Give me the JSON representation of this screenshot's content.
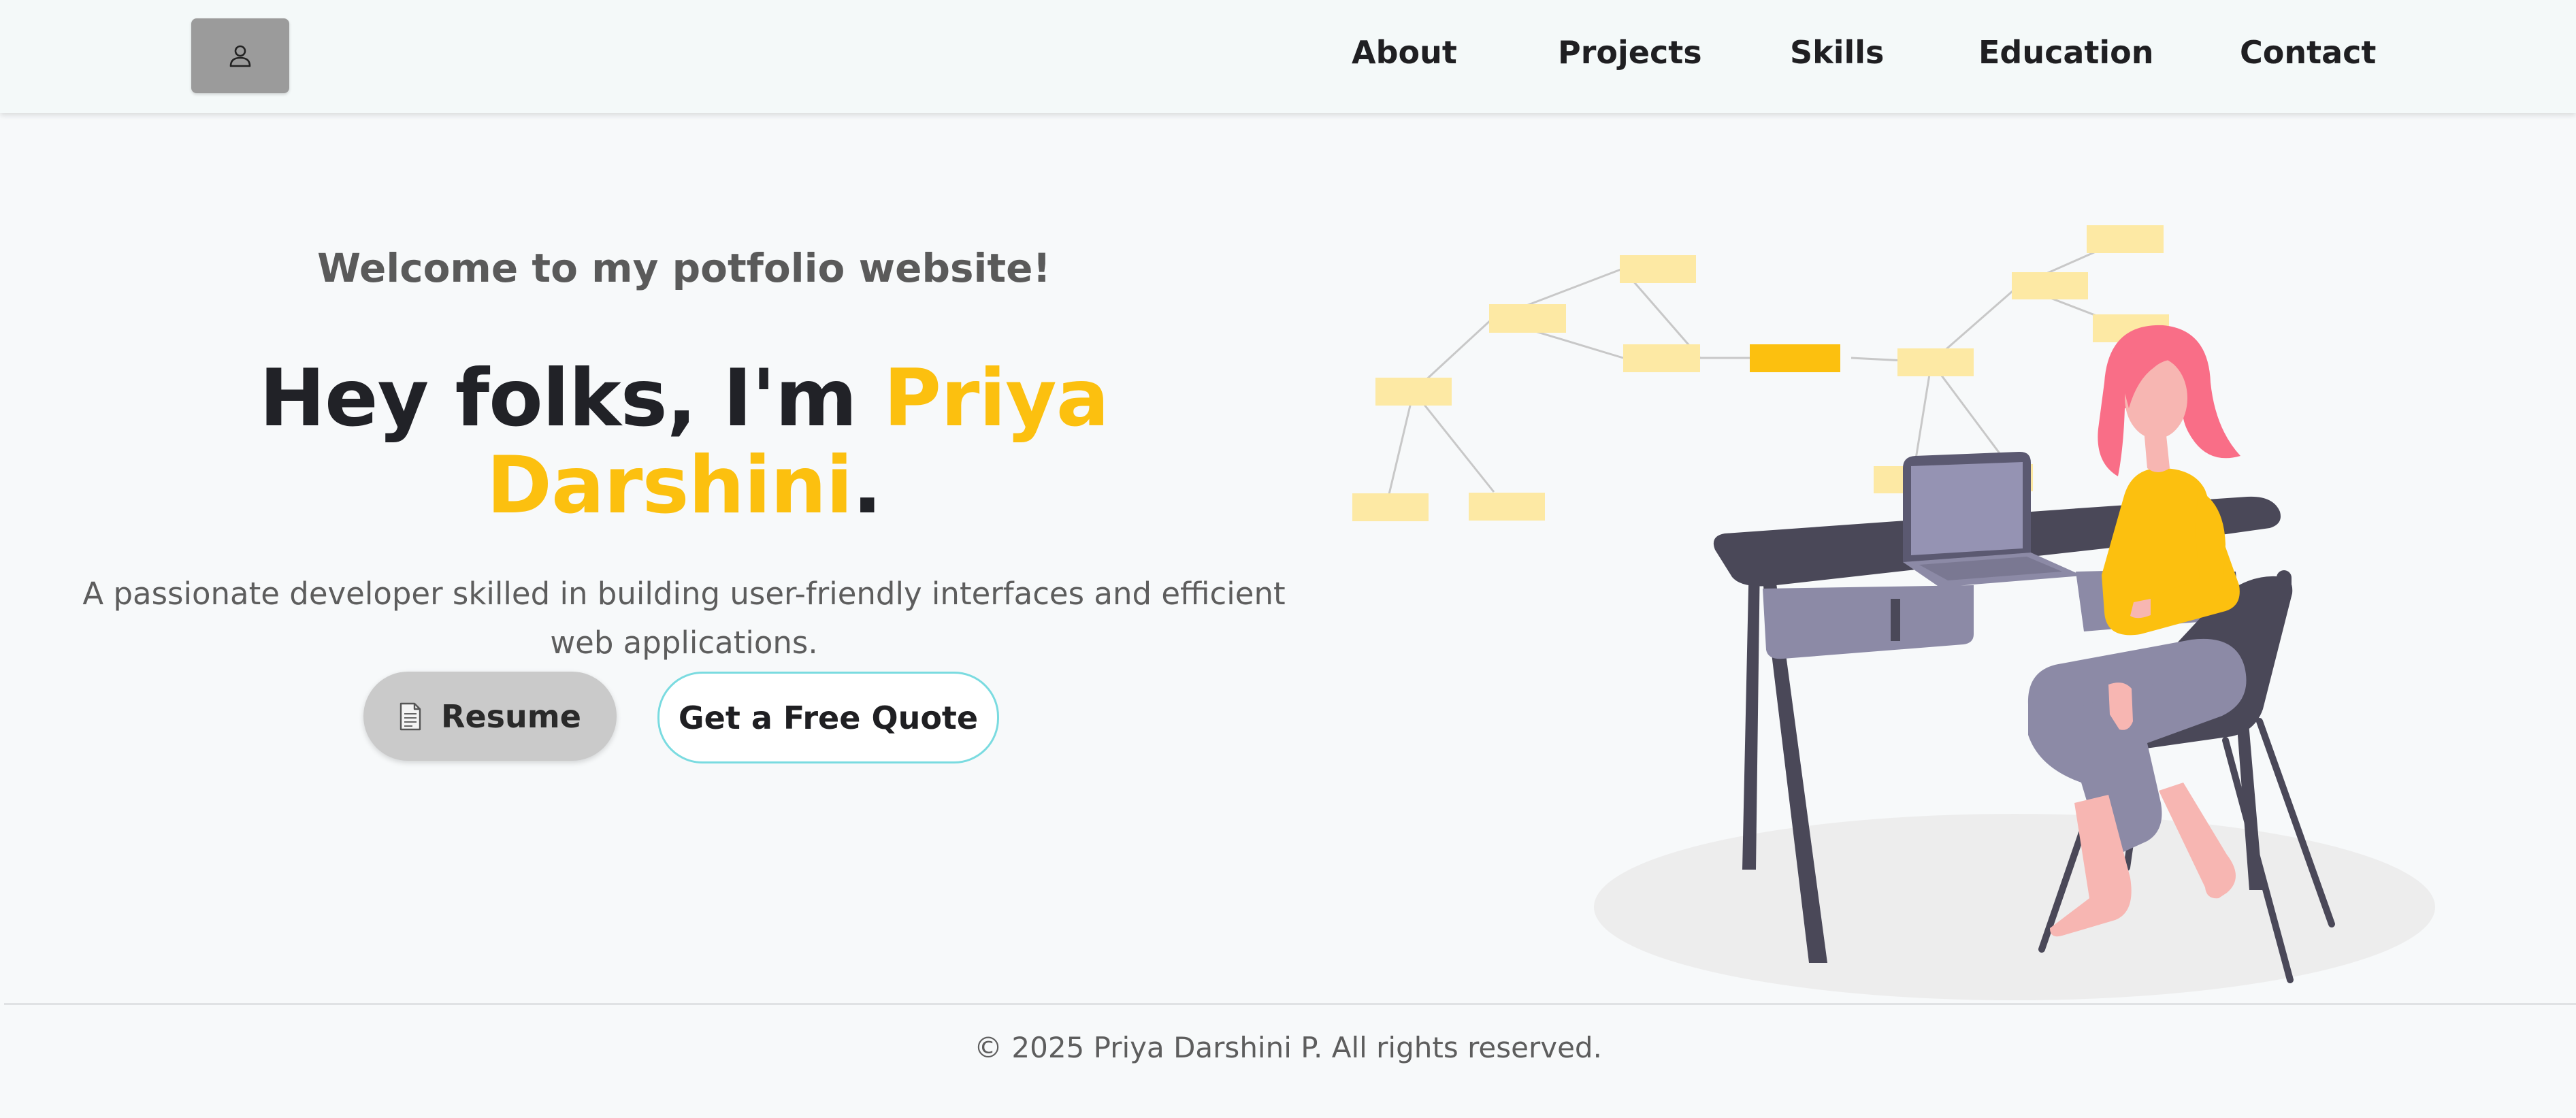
{
  "nav": {
    "logo_icon": "user-icon",
    "links": [
      "About",
      "Projects",
      "Skills",
      "Education",
      "Contact"
    ]
  },
  "hero": {
    "welcome": "Welcome to my potfolio website!",
    "greeting": "Hey folks, I'm ",
    "name": "Priya Darshini",
    "period": ".",
    "tagline": "A passionate developer skilled in building user-friendly interfaces and efficient web applications.",
    "resume_label": "Resume",
    "resume_icon": "document-icon",
    "quote_label": "Get a Free Quote"
  },
  "colors": {
    "accent": "#fcc00f",
    "text": "#212227",
    "muted": "#5d5d5d",
    "quote_border": "#7adbe0",
    "logo_bg": "#9b9b9b"
  },
  "footer": {
    "copyright": "© 2025 Priya Darshini P. All rights reserved."
  }
}
